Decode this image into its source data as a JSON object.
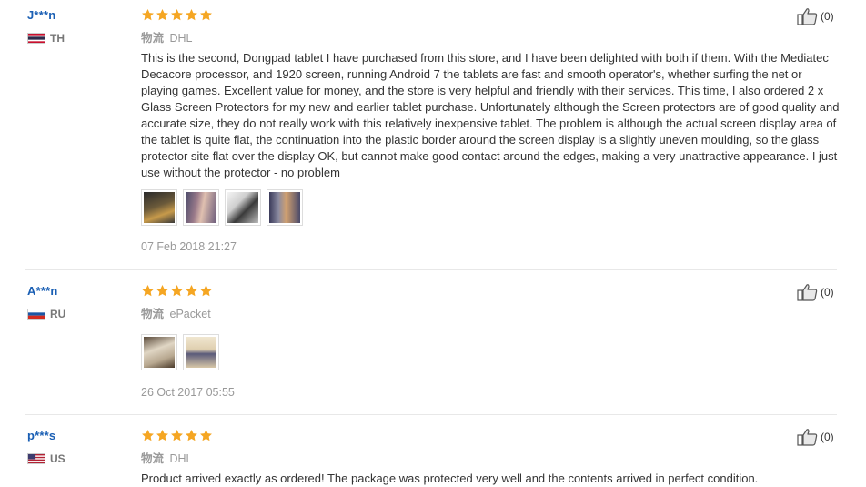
{
  "reviews": [
    {
      "user": "J***n",
      "country": "TH",
      "rating": 5,
      "shipping_label": "物流",
      "shipping_method": "DHL",
      "text": "This is the second, Dongpad tablet I have purchased from this store, and I have been delighted with both if them. With the Mediatec Decacore processor, and 1920 screen, running Android 7 the tablets are fast and smooth operator's, whether surfing the net or playing games. Excellent value for money, and the store is very helpful and friendly with their services. This time, I also ordered 2 x Glass Screen Protectors for my new and earlier tablet purchase. Unfortunately although the Screen protectors are of good quality and accurate size, they do not really work with this relatively inexpensive tablet. The problem is although the actual screen display area of the tablet is quite flat, the continuation into the plastic border around the screen display is a slightly uneven moulding, so the glass protector site flat over the display OK, but cannot make good contact around the edges, making a very unattractive appearance. I just use without the protector - no problem",
      "photos": 4,
      "date": "07 Feb 2018 21:27",
      "helpful_count": "(0)"
    },
    {
      "user": "A***n",
      "country": "RU",
      "rating": 5,
      "shipping_label": "物流",
      "shipping_method": "ePacket",
      "text": "",
      "photos": 2,
      "date": "26 Oct 2017 05:55",
      "helpful_count": "(0)"
    },
    {
      "user": "p***s",
      "country": "US",
      "rating": 5,
      "shipping_label": "物流",
      "shipping_method": "DHL",
      "text": "Product arrived exactly as ordered! The package was protected very well and the contents arrived in perfect condition.",
      "photos": 0,
      "date": "",
      "helpful_count": "(0)"
    }
  ],
  "colors": {
    "star": "#f5a623",
    "username": "#1a5fb4",
    "muted": "#999999"
  },
  "icons": {
    "star": "star-icon",
    "thumbs_up": "thumbs-up-icon",
    "flag_th": "flag-th-icon",
    "flag_ru": "flag-ru-icon",
    "flag_us": "flag-us-icon"
  }
}
